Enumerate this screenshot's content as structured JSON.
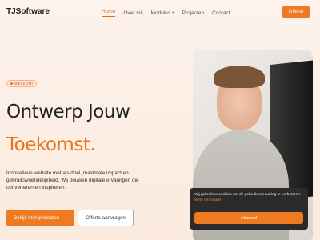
{
  "nav": {
    "logo": "TJSoftware",
    "items": [
      {
        "label": "Home"
      },
      {
        "label": "Over mij"
      },
      {
        "label": "Modules"
      },
      {
        "label": "Projecten"
      },
      {
        "label": "Contact"
      }
    ],
    "cta": "Offerte"
  },
  "hero": {
    "badge": "WELKOM!",
    "title_line1": "Ontwerp Jouw",
    "title_line2": "Toekomst.",
    "lead": "Innovatieve website met als doel, maximale impact en gebruiksvriendelijkheid. Wij bouwen digitale ervaringen die converteren en inspireren.",
    "btn_primary": "Bekijk mijn projecten",
    "btn_secondary": "Offerte aanvragen"
  },
  "cookie": {
    "text": "Wij gebruiken cookies om de gebruikerservaring te verbeteren.",
    "link": "Meer informatie",
    "accept": "Akkoord"
  },
  "colors": {
    "accent": "#ee7a21",
    "dark": "#222222"
  }
}
